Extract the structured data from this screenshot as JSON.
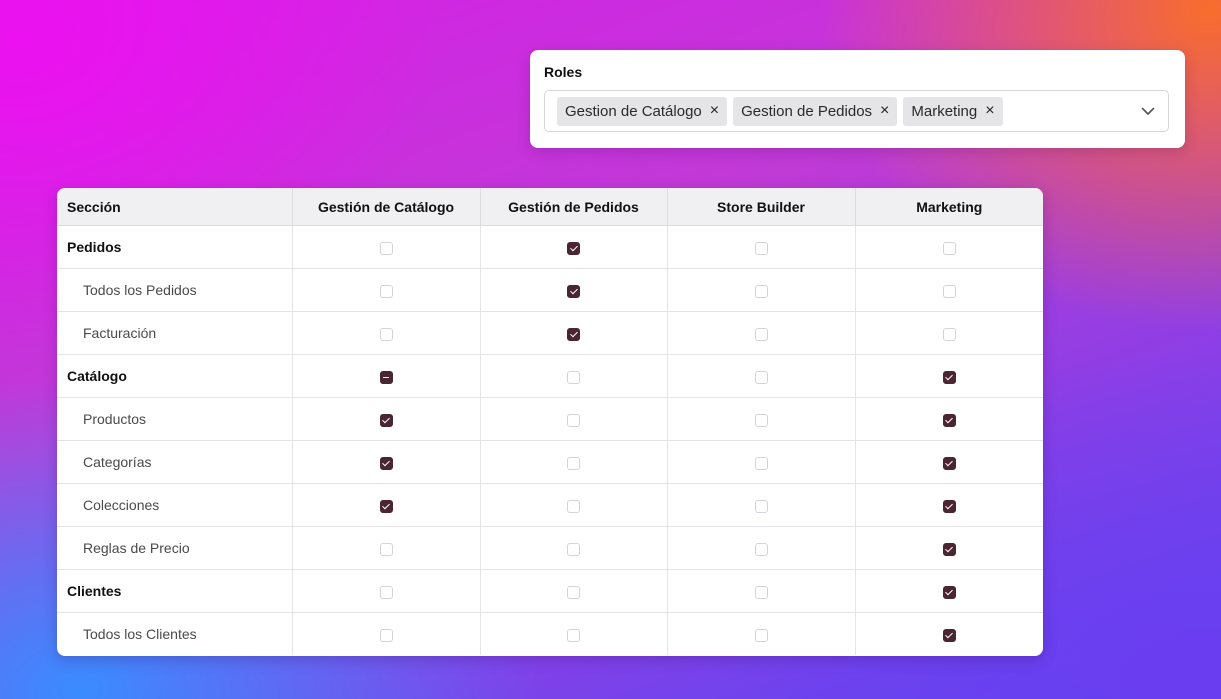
{
  "roles": {
    "label": "Roles",
    "selected": [
      {
        "label": "Gestion de Catálogo"
      },
      {
        "label": "Gestion de Pedidos"
      },
      {
        "label": "Marketing"
      }
    ],
    "remove_glyph": "×",
    "dropdown_icon": "chevron-down-icon"
  },
  "table": {
    "headers": [
      "Sección",
      "Gestión de Catálogo",
      "Gestión de Pedidos",
      "Store Builder",
      "Marketing"
    ],
    "rows": [
      {
        "label": "Pedidos",
        "level": "parent",
        "states": [
          "off",
          "on",
          "off",
          "off"
        ]
      },
      {
        "label": "Todos los Pedidos",
        "level": "child",
        "states": [
          "off",
          "on",
          "off",
          "off"
        ]
      },
      {
        "label": "Facturación",
        "level": "child",
        "states": [
          "off",
          "on",
          "off",
          "off"
        ]
      },
      {
        "label": "Catálogo",
        "level": "parent",
        "states": [
          "partial",
          "off",
          "off",
          "on"
        ]
      },
      {
        "label": "Productos",
        "level": "child",
        "states": [
          "on",
          "off",
          "off",
          "on"
        ]
      },
      {
        "label": "Categorías",
        "level": "child",
        "states": [
          "on",
          "off",
          "off",
          "on"
        ]
      },
      {
        "label": "Colecciones",
        "level": "child",
        "states": [
          "on",
          "off",
          "off",
          "on"
        ]
      },
      {
        "label": "Reglas de Precio",
        "level": "child",
        "states": [
          "off",
          "off",
          "off",
          "on"
        ]
      },
      {
        "label": "Clientes",
        "level": "parent",
        "states": [
          "off",
          "off",
          "off",
          "on"
        ]
      },
      {
        "label": "Todos los Clientes",
        "level": "child",
        "states": [
          "off",
          "off",
          "off",
          "on"
        ]
      }
    ]
  },
  "colors": {
    "checked": "#4a2632",
    "header_bg": "#f0f0f2",
    "chip_bg": "#e5e5e8"
  }
}
